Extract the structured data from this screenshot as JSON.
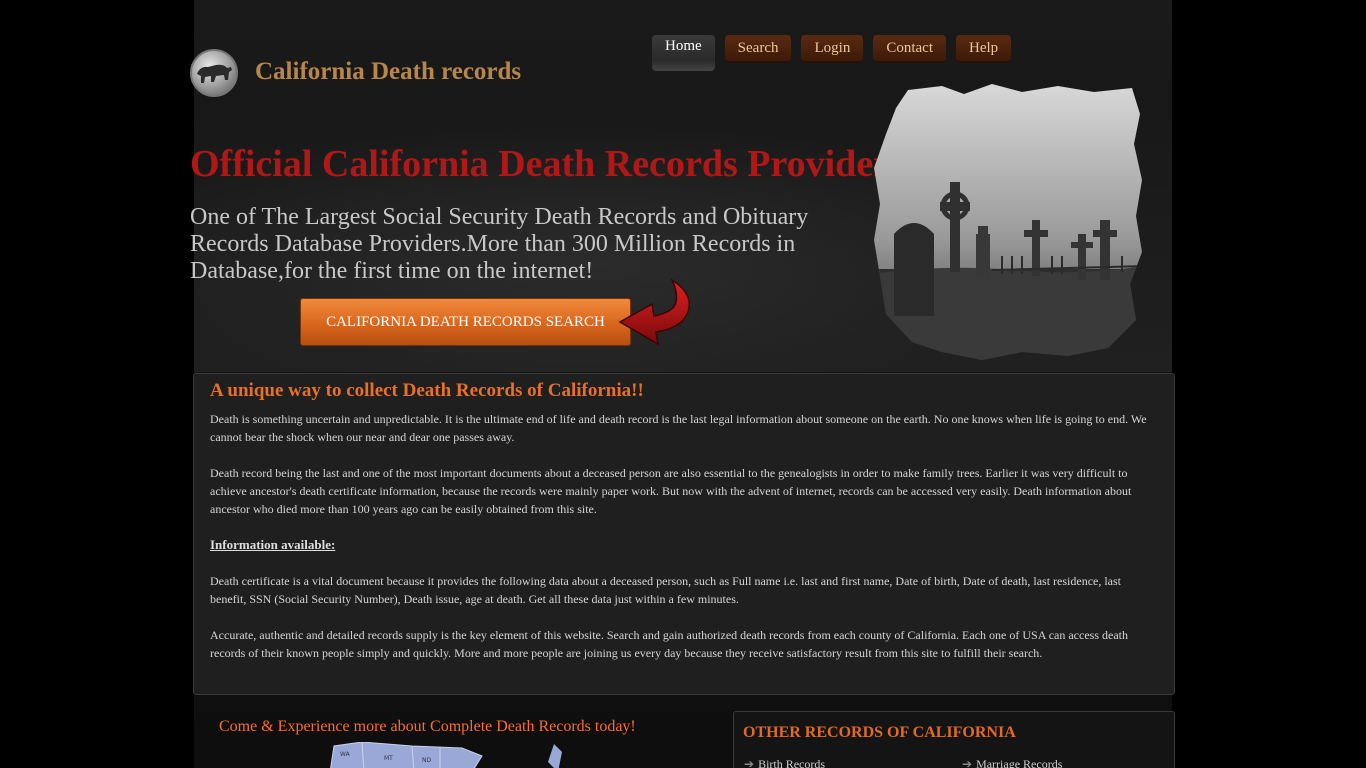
{
  "header": {
    "site_title": "California Death records",
    "logo_icon": "bear-logo-icon"
  },
  "nav": {
    "items": [
      {
        "label": "Home",
        "active": true
      },
      {
        "label": "Search",
        "active": false
      },
      {
        "label": "Login",
        "active": false
      },
      {
        "label": "Contact",
        "active": false
      },
      {
        "label": "Help",
        "active": false
      }
    ]
  },
  "hero": {
    "title": "Official California Death Records Provider",
    "subtitle": "One of The Largest Social Security Death Records and Obituary Records Database Providers.More than 300 Million Records in Database,for the first time on the internet!",
    "cta_label": "California Death Records Search",
    "image_icon": "cemetery-image",
    "arrow_icon": "red-arrow-icon"
  },
  "info": {
    "heading": "A unique way to collect Death Records of California!!",
    "para1": "Death is something uncertain and unpredictable. It is the ultimate end of life and death record is the last legal information about someone on the earth. No one knows when life is going to end. We cannot bear the shock when our near and dear one passes away.",
    "para2": "Death record being the last and one of the most important documents about a deceased person are also essential to the genealogists in order to make family trees. Earlier it was very difficult to achieve ancestor's death certificate information, because the records were mainly paper work. But now with the advent of internet, records can be accessed very easily. Death information about ancestor who died more than 100 years ago can be easily obtained from this site.",
    "subheading": "Information available:",
    "para3": "Death certificate is a vital document because it provides the following data about a deceased person, such as Full name i.e. last and first name, Date of birth, Date of death, last residence, last benefit, SSN (Social Security Number), Death issue, age at death. Get all these data just within a few minutes.",
    "para4": "Accurate, authentic and detailed records supply is the key element of this website. Search and gain authorized death records from each county of California. Each one of USA can access death records of their known people simply and quickly. More and more people are joining us every day because they receive satisfactory result from this site to fulfill their search."
  },
  "promo": {
    "text": "Come & Experience more about Complete Death Records today!",
    "map_labels": [
      "WA",
      "MT",
      "ND"
    ]
  },
  "other_records": {
    "heading": "Other Records of California",
    "links": [
      "Birth Records",
      "Marriage Records"
    ]
  },
  "colors": {
    "title_red": "#b01818",
    "accent_orange": "#e8702a",
    "cta_orange": "#d9661c",
    "site_title_gold": "#b8864a"
  }
}
